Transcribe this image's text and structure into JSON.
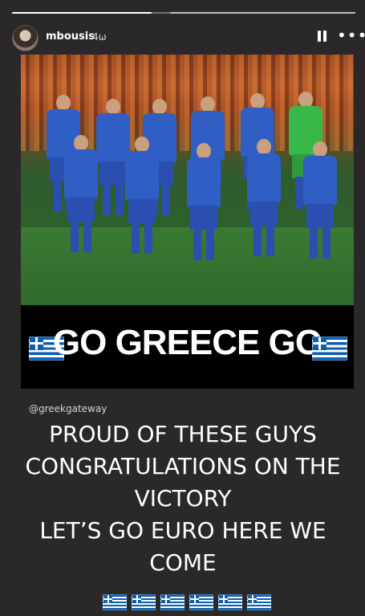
{
  "story": {
    "username": "mbousis",
    "time": "4ω",
    "handle": "@greekgateway",
    "banner_text": "GO GREECE GO",
    "caption_lines": [
      "PROUD OF THESE GUYS",
      "CONGRATULATIONS ON THE",
      "VICTORY",
      "LET’S GO EURO HERE WE",
      "COME"
    ],
    "flag_emoji_count": 6
  },
  "icons": {
    "pause": "pause-icon",
    "more": "more-icon",
    "flag": "greece-flag-icon"
  },
  "colors": {
    "background": "#2a2829",
    "greek_blue": "#0d5eaf",
    "kit_blue": "#2f5fc4"
  }
}
